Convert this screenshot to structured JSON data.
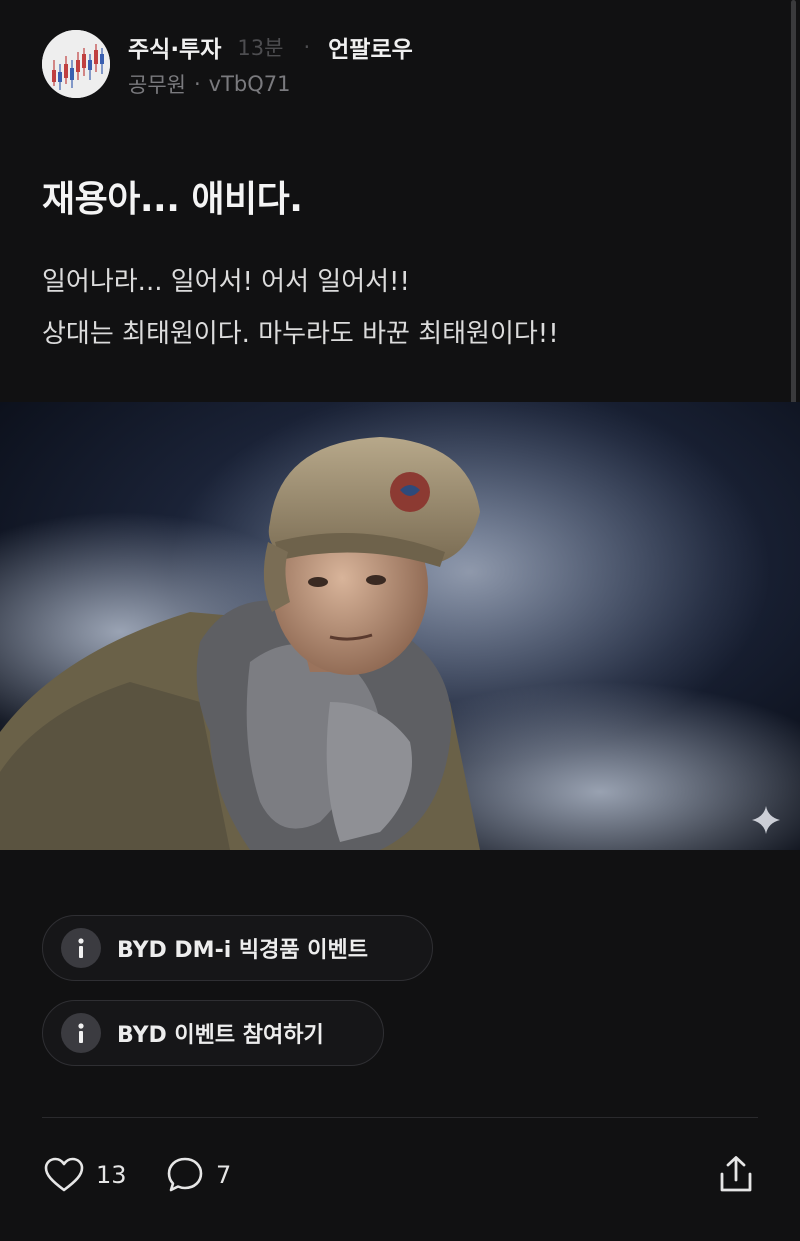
{
  "post": {
    "board": "주식·투자",
    "time": "13분",
    "separator": "·",
    "unfollow_label": "언팔로우",
    "author_job": "공무원",
    "author_dot": "·",
    "author_id": "vTbQ71",
    "title": "재용아... 애비다.",
    "body": [
      "일어나라... 일어서! 어서 일어서!!",
      "상대는 최태원이다. 마누라도 바꾼 최태원이다!!"
    ]
  },
  "events": [
    {
      "icon": "info-icon",
      "label": "BYD DM-i 빅경품 이벤트"
    },
    {
      "icon": "info-icon",
      "label": "BYD 이벤트 참여하기"
    }
  ],
  "actions": {
    "likes": "13",
    "comments": "7"
  },
  "icons": {
    "avatar": "stock-chart-avatar",
    "image_overlay": "sparkle-icon",
    "like": "heart-icon",
    "comment": "speech-bubble-icon",
    "share": "share-icon"
  },
  "colors": {
    "background": "#111112",
    "muted_text": "#7a7a7e",
    "pill_border": "#2f2f33"
  }
}
